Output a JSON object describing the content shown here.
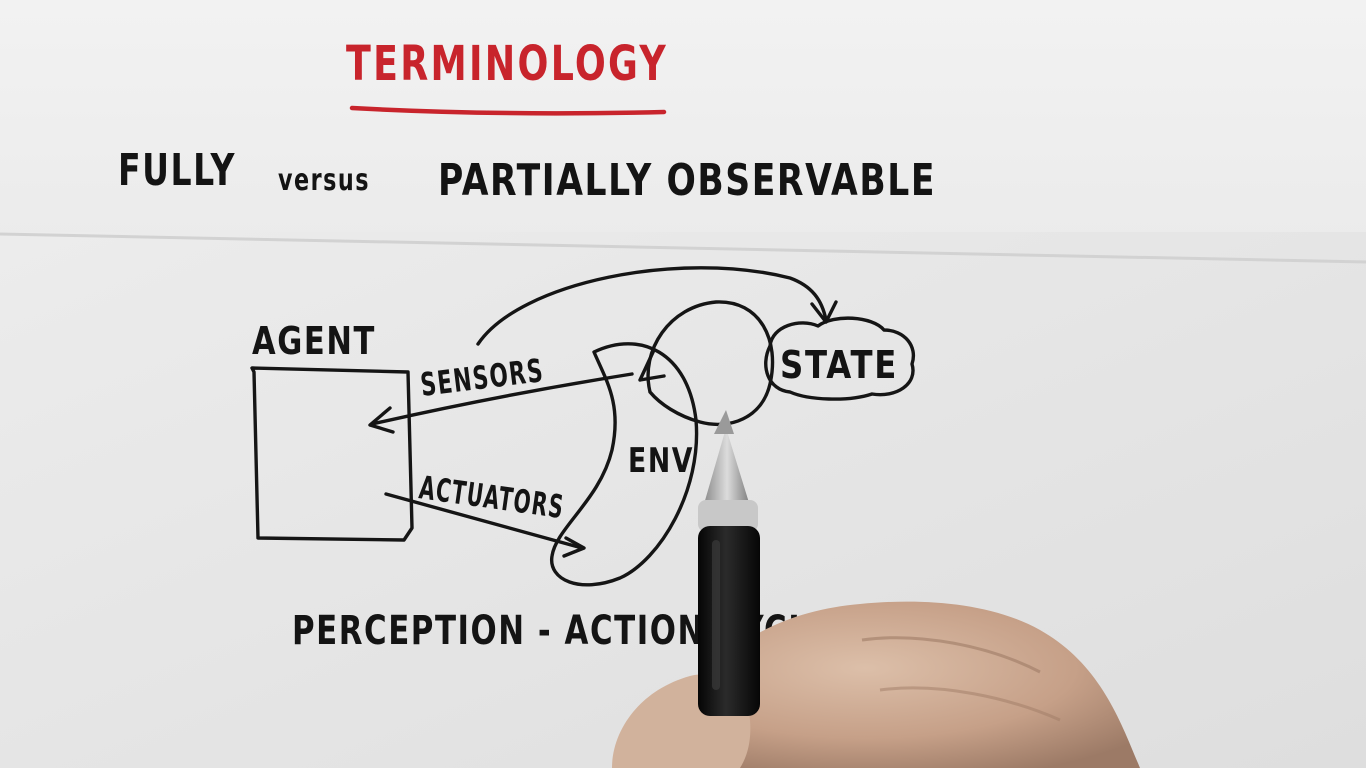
{
  "title": "TERMINOLOGY",
  "subtitle": {
    "left": "FULLY",
    "middle": "versus",
    "right": "PARTIALLY OBSERVABLE"
  },
  "diagram": {
    "agent_label": "AGENT",
    "sensors_label": "SENSORS",
    "actuators_label": "ACTUATORS",
    "env_label": "ENV",
    "state_label": "STATE"
  },
  "caption": "PERCEPTION - ACTION CYCLE",
  "colors": {
    "paper_top": "#eeeeee",
    "paper_bottom": "#e4e4e4",
    "ink": "#151515",
    "title_red": "#c8242c",
    "skin": "#c9a78f",
    "pen_body": "#111111",
    "pen_tip": "#a8a8a8"
  },
  "icons": [
    "pen-icon",
    "hand-icon"
  ]
}
